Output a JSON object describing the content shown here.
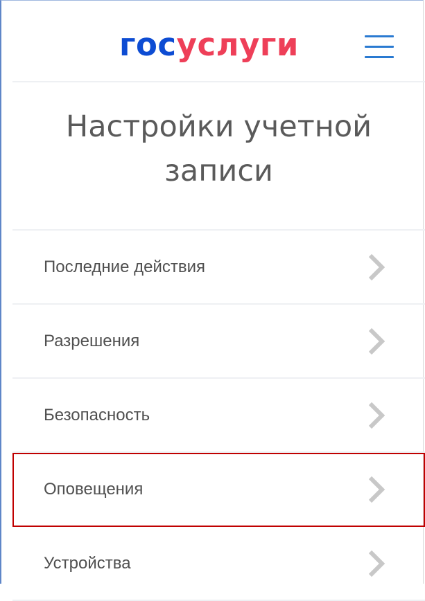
{
  "colors": {
    "logo_blue": "#0d4cd3",
    "logo_red": "#ee3f58",
    "accent": "#2a7ad1",
    "chevron": "#c8c8c8",
    "highlight": "#c00000"
  },
  "header": {
    "logo": {
      "part_blue": "гос",
      "part_red": "услуги"
    },
    "menu_icon": "hamburger-icon"
  },
  "page": {
    "title": "Настройки учетной записи"
  },
  "menu": {
    "items": [
      {
        "label": "Последние действия",
        "icon": "chevron-right-icon",
        "highlighted": false
      },
      {
        "label": "Разрешения",
        "icon": "chevron-right-icon",
        "highlighted": false
      },
      {
        "label": "Безопасность",
        "icon": "chevron-right-icon",
        "highlighted": false
      },
      {
        "label": "Оповещения",
        "icon": "chevron-right-icon",
        "highlighted": true
      },
      {
        "label": "Устройства",
        "icon": "chevron-right-icon",
        "highlighted": false
      }
    ]
  }
}
